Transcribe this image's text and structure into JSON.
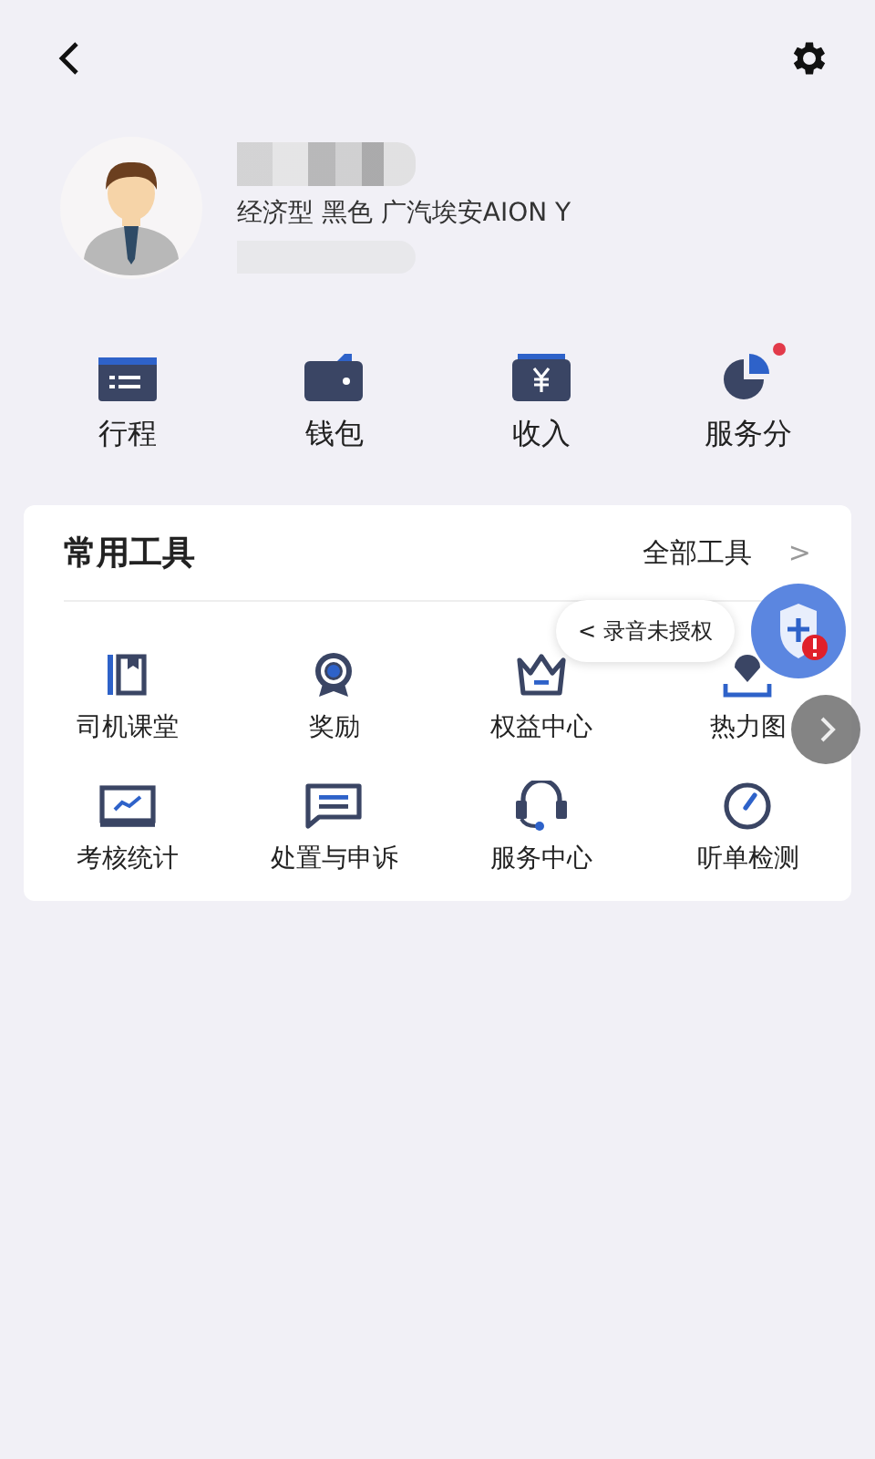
{
  "profile": {
    "car_info": "经济型 黑色 广汽埃安AION Y"
  },
  "shortcuts": [
    {
      "label": "行程",
      "kind": "trips",
      "badge": false
    },
    {
      "label": "钱包",
      "kind": "wallet",
      "badge": false
    },
    {
      "label": "收入",
      "kind": "income",
      "badge": false
    },
    {
      "label": "服务分",
      "kind": "score",
      "badge": true
    }
  ],
  "tools": {
    "title": "常用工具",
    "all_link": "全部工具",
    "chevron": ">",
    "items": [
      {
        "label": "司机课堂",
        "kind": "book"
      },
      {
        "label": "奖励",
        "kind": "medal"
      },
      {
        "label": "权益中心",
        "kind": "crown"
      },
      {
        "label": "热力图",
        "kind": "pin"
      },
      {
        "label": "考核统计",
        "kind": "chart"
      },
      {
        "label": "处置与申诉",
        "kind": "message"
      },
      {
        "label": "服务中心",
        "kind": "headset"
      },
      {
        "label": "听单检测",
        "kind": "gauge"
      }
    ]
  },
  "recording_prompt": {
    "chevron": "<",
    "text": "录音未授权"
  }
}
